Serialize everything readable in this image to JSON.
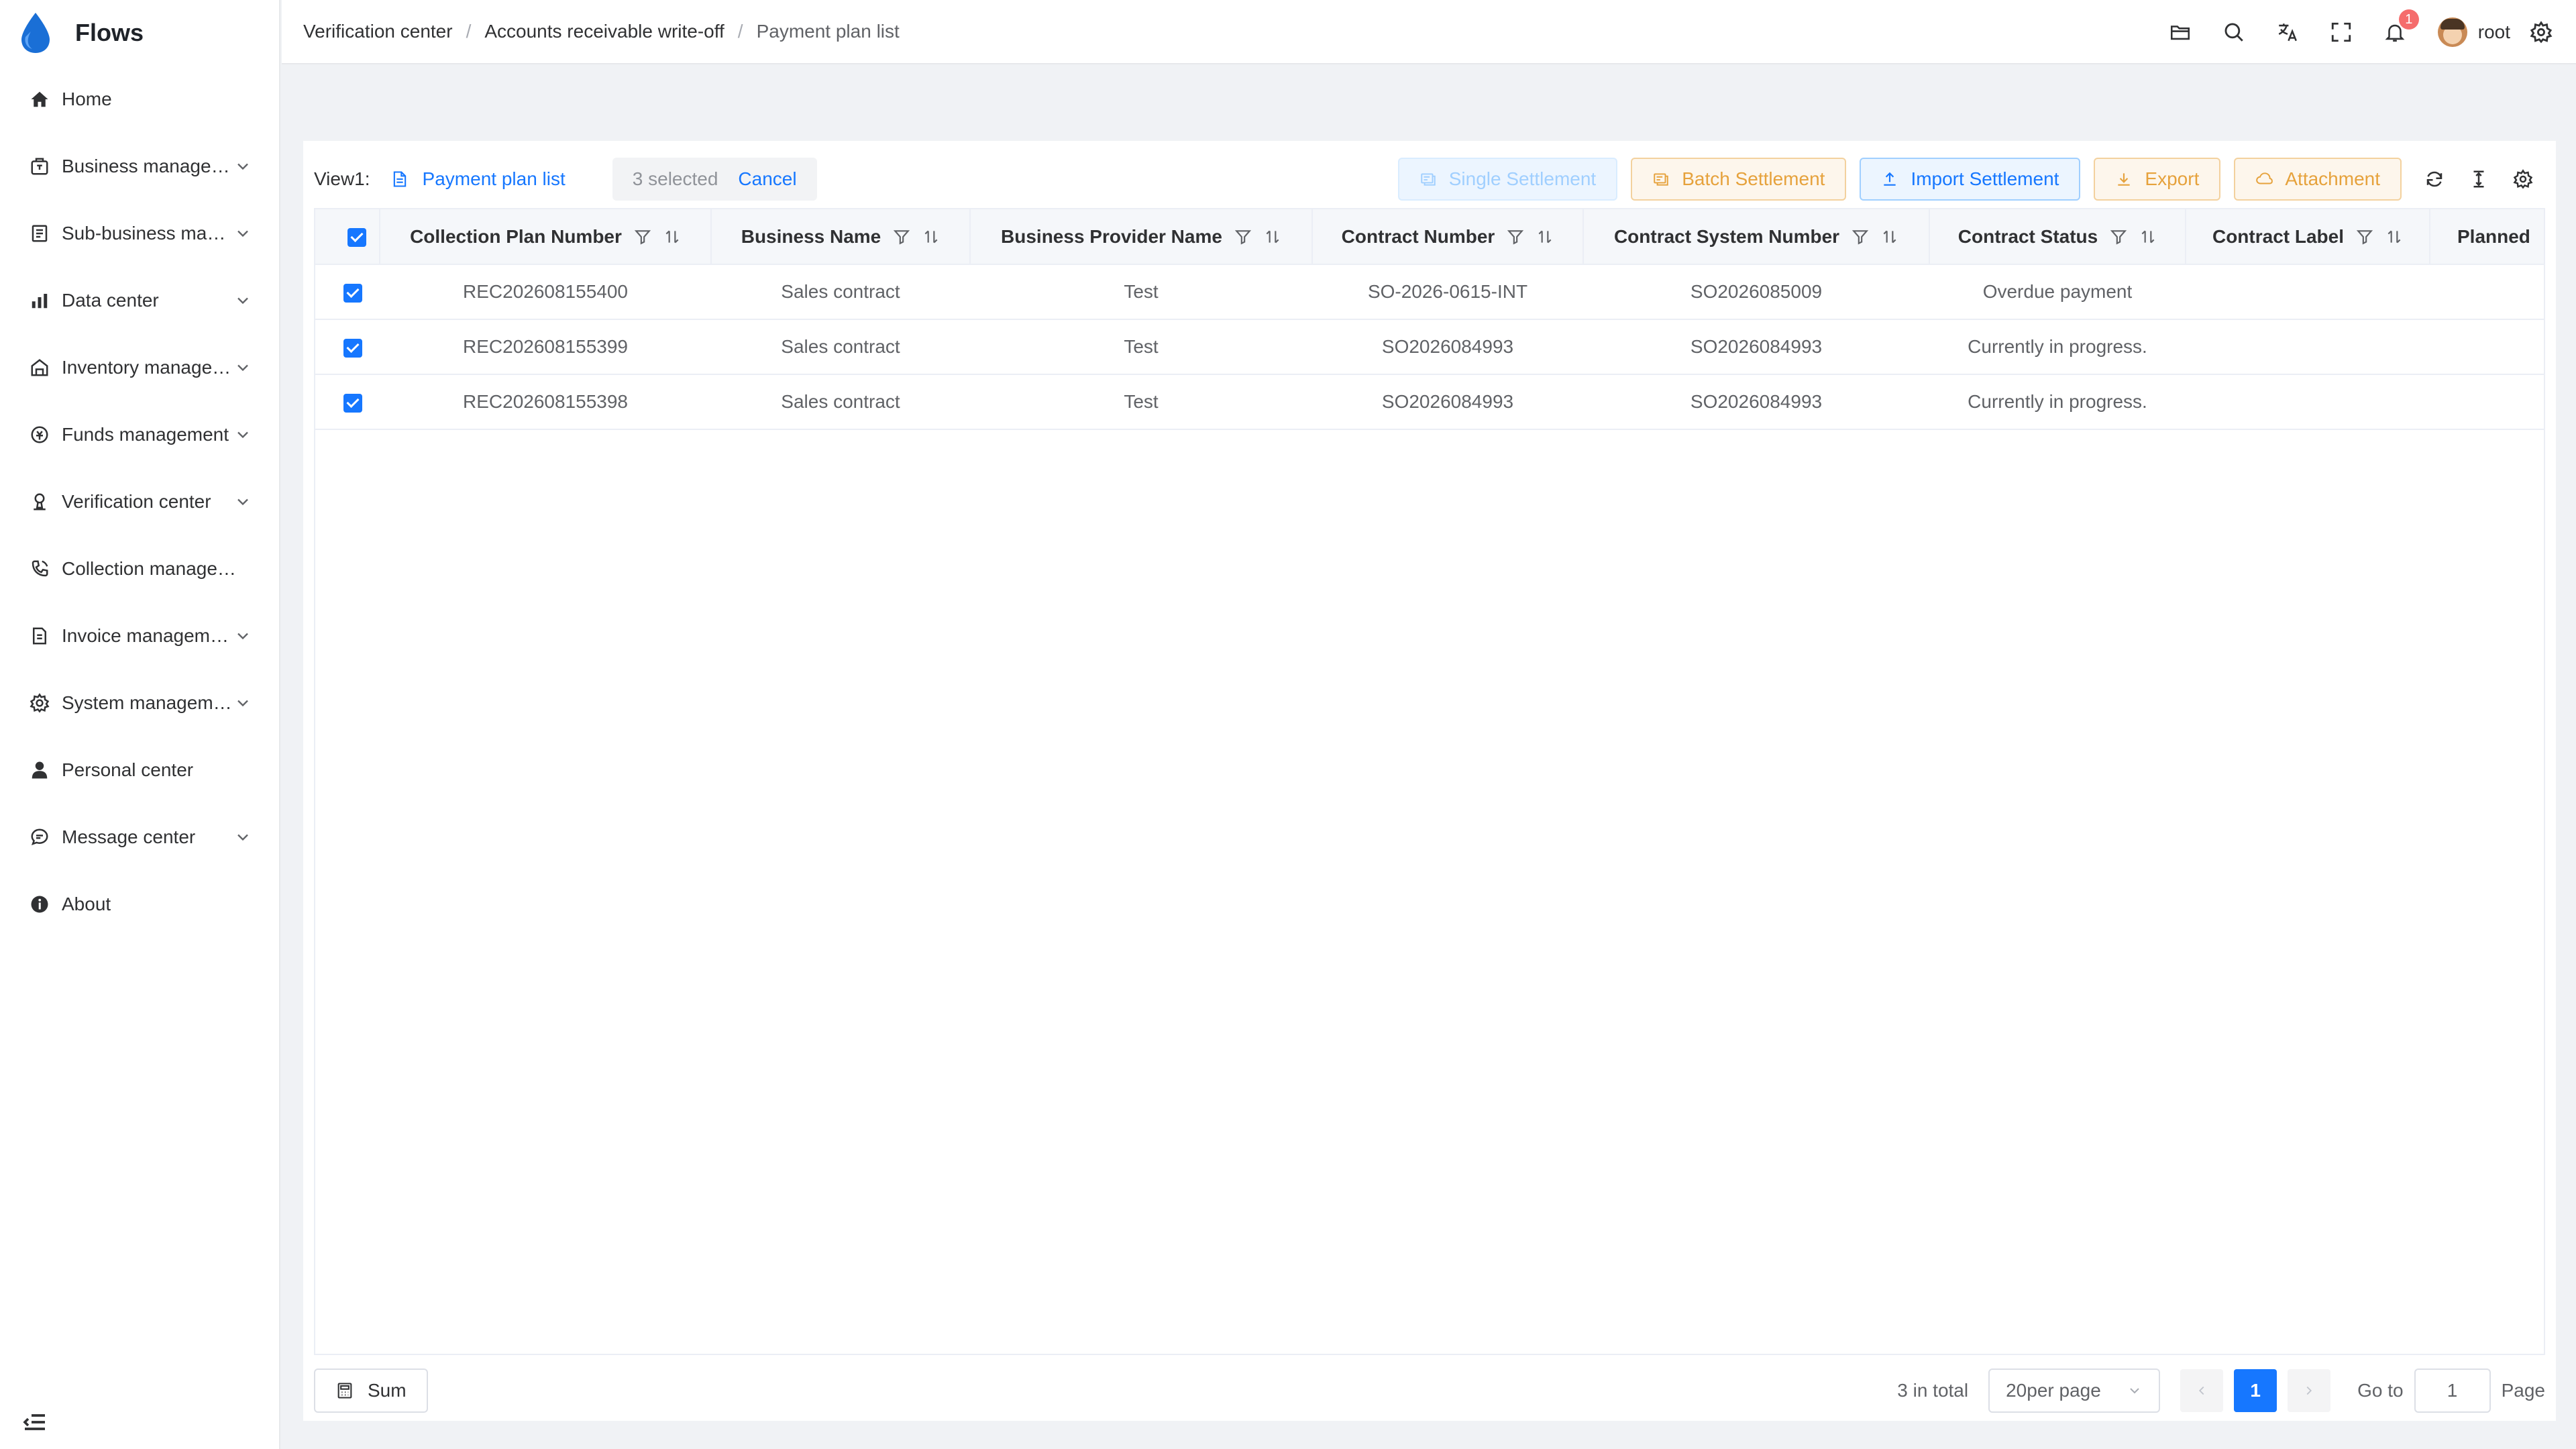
{
  "app": {
    "name": "Flows"
  },
  "sidebar": {
    "items": [
      {
        "label": "Home",
        "icon": "home-icon",
        "expandable": false
      },
      {
        "label": "Business management",
        "icon": "briefcase-icon",
        "expandable": true
      },
      {
        "label": "Sub-business management",
        "icon": "document-list-icon",
        "expandable": true
      },
      {
        "label": "Data center",
        "icon": "bar-chart-icon",
        "expandable": true
      },
      {
        "label": "Inventory management",
        "icon": "warehouse-icon",
        "expandable": true
      },
      {
        "label": "Funds management",
        "icon": "money-icon",
        "expandable": true
      },
      {
        "label": "Verification center",
        "icon": "verify-icon",
        "expandable": true
      },
      {
        "label": "Collection management",
        "icon": "phone-icon",
        "expandable": false
      },
      {
        "label": "Invoice management",
        "icon": "invoice-icon",
        "expandable": true
      },
      {
        "label": "System management",
        "icon": "gear-icon",
        "expandable": true
      },
      {
        "label": "Personal center",
        "icon": "user-icon",
        "expandable": false
      },
      {
        "label": "Message center",
        "icon": "message-icon",
        "expandable": true
      },
      {
        "label": "About",
        "icon": "info-icon",
        "expandable": false
      }
    ]
  },
  "header": {
    "breadcrumb": [
      "Verification center",
      "Accounts receivable write-off",
      "Payment plan list"
    ],
    "notification_count": "1",
    "username": "root"
  },
  "toolbar": {
    "view_label": "View1:",
    "view_name": "Payment plan list",
    "selected_text": "3 selected",
    "cancel_label": "Cancel",
    "buttons": {
      "single": "Single Settlement",
      "batch": "Batch Settlement",
      "import": "Import Settlement",
      "export": "Export",
      "attachment": "Attachment"
    }
  },
  "table": {
    "columns": [
      "Collection Plan Number",
      "Business Name",
      "Business Provider Name",
      "Contract Number",
      "Contract System Number",
      "Contract Status",
      "Contract Label",
      "Planned"
    ],
    "rows": [
      [
        "REC202608155400",
        "Sales contract",
        "Test",
        "SO-2026-0615-INT",
        "SO2026085009",
        "Overdue payment",
        "",
        ""
      ],
      [
        "REC202608155399",
        "Sales contract",
        "Test",
        "SO2026084993",
        "SO2026084993",
        "Currently in progress.",
        "",
        ""
      ],
      [
        "REC202608155398",
        "Sales contract",
        "Test",
        "SO2026084993",
        "SO2026084993",
        "Currently in progress.",
        "",
        ""
      ]
    ]
  },
  "footer": {
    "sum_label": "Sum",
    "total_text": "3 in total",
    "page_size": "20per page",
    "current_page": "1",
    "goto_label": "Go to",
    "goto_value": "1",
    "page_word": "Page"
  },
  "colors": {
    "primary": "#1677ff",
    "warning": "#e6a23c",
    "badge": "#f56c6c"
  }
}
